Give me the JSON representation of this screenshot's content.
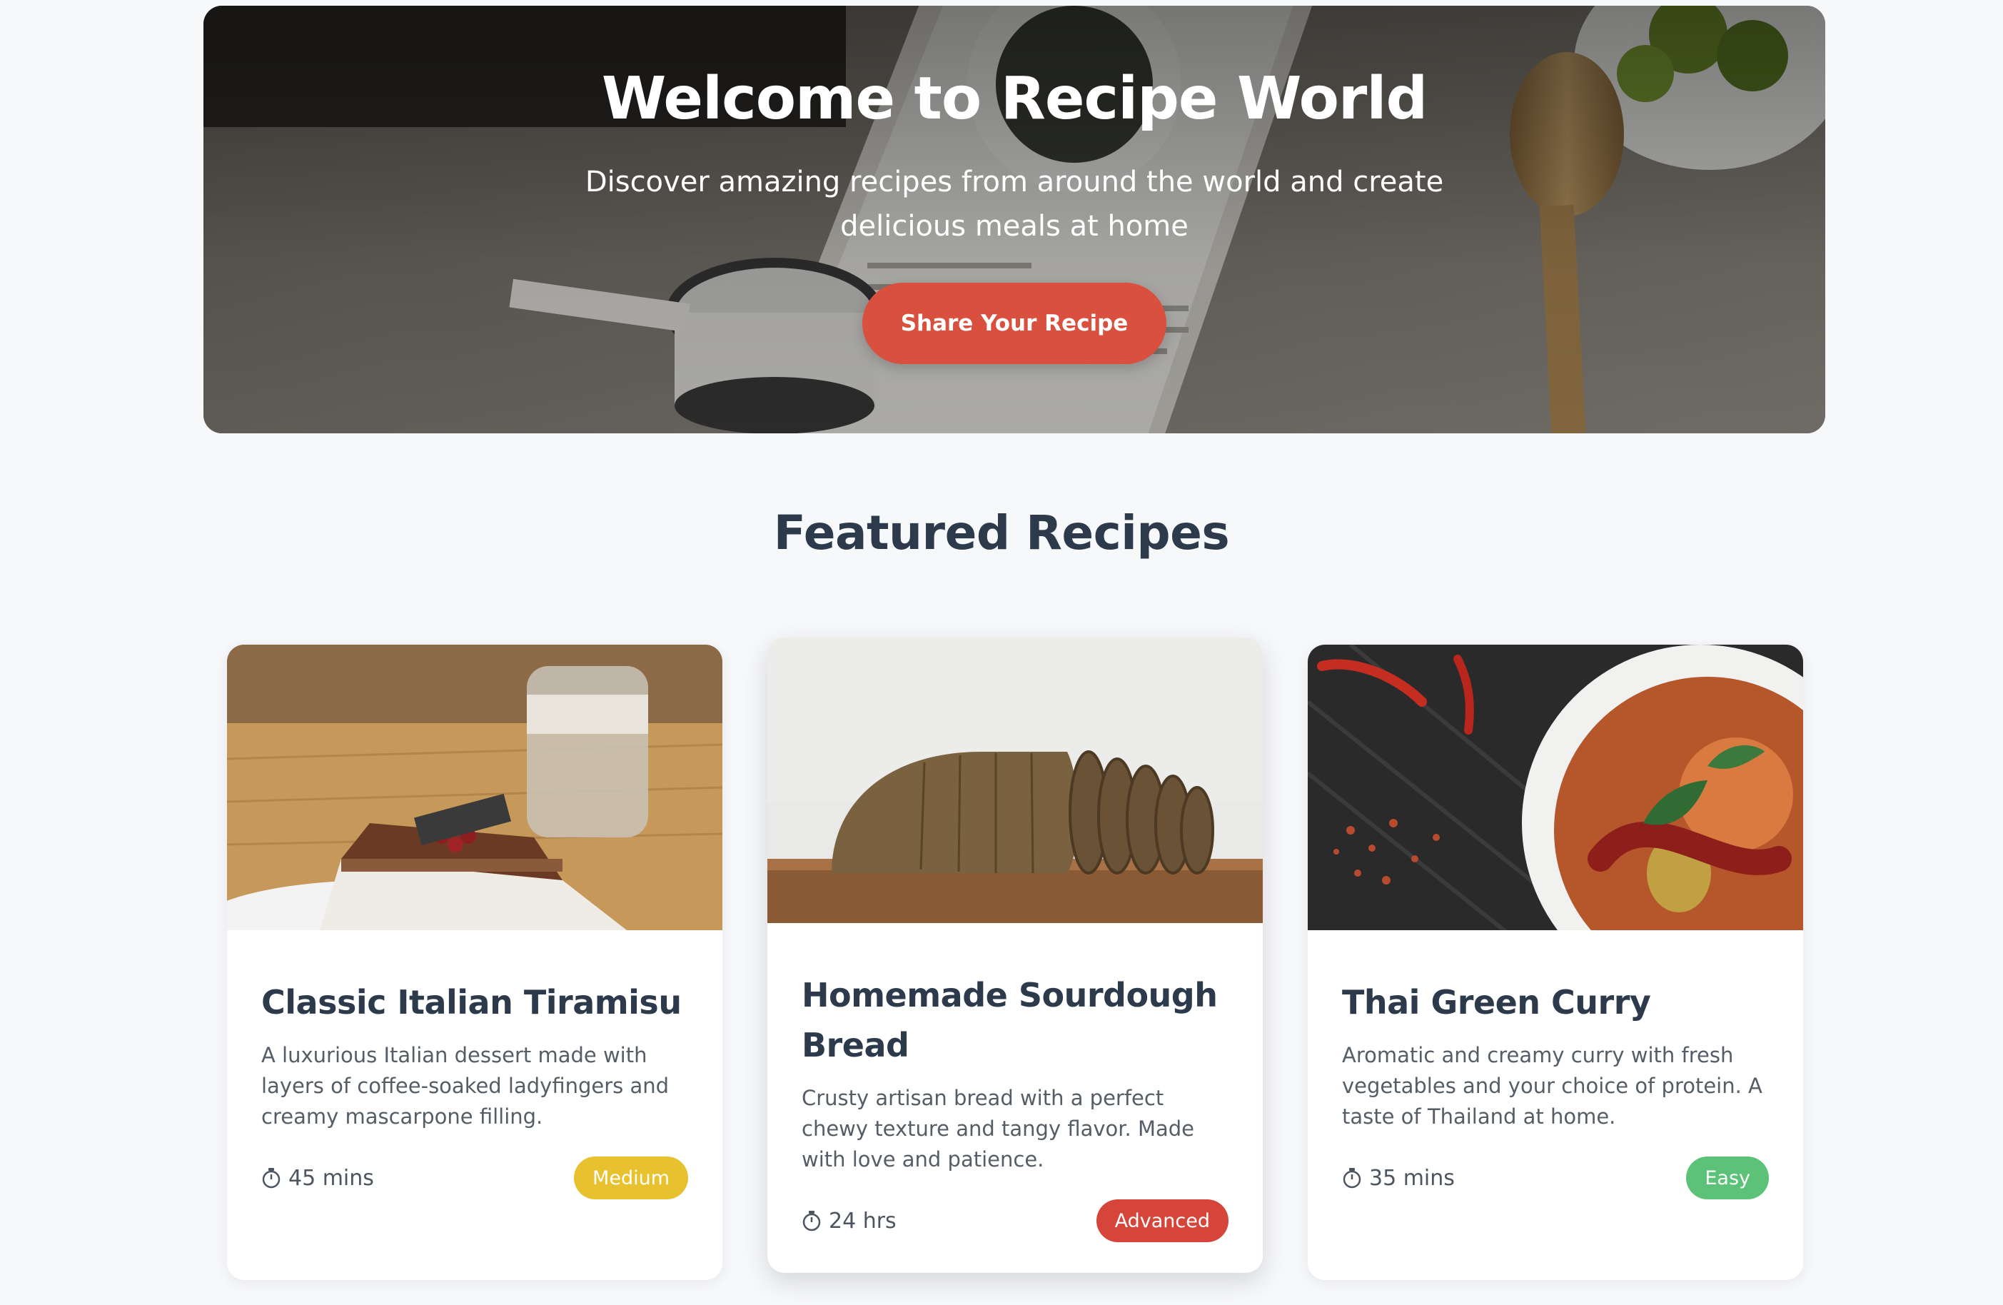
{
  "hero": {
    "title": "Welcome to Recipe World",
    "subtitle": "Discover amazing recipes from around the world and create delicious meals at home",
    "cta_label": "Share Your Recipe"
  },
  "featured": {
    "title": "Featured Recipes",
    "cards": [
      {
        "title": "Classic Italian Tiramisu",
        "description": "A luxurious Italian dessert made with layers of coffee-soaked ladyfingers and creamy mascarpone filling.",
        "time": "45 mins",
        "difficulty": "Medium",
        "difficulty_color": "#e8c12f"
      },
      {
        "title": "Homemade Sourdough Bread",
        "description": "Crusty artisan bread with a perfect chewy texture and tangy flavor. Made with love and patience.",
        "time": "24 hrs",
        "difficulty": "Advanced",
        "difficulty_color": "#d6453a"
      },
      {
        "title": "Thai Green Curry",
        "description": "Aromatic and creamy curry with fresh vegetables and your choice of protein. A taste of Thailand at home.",
        "time": "35 mins",
        "difficulty": "Easy",
        "difficulty_color": "#5cc278"
      }
    ]
  },
  "colors": {
    "accent": "#d9503f",
    "heading": "#2c3a4b",
    "background": "#f7f8fa"
  },
  "icons": {
    "time": "timer-icon"
  }
}
